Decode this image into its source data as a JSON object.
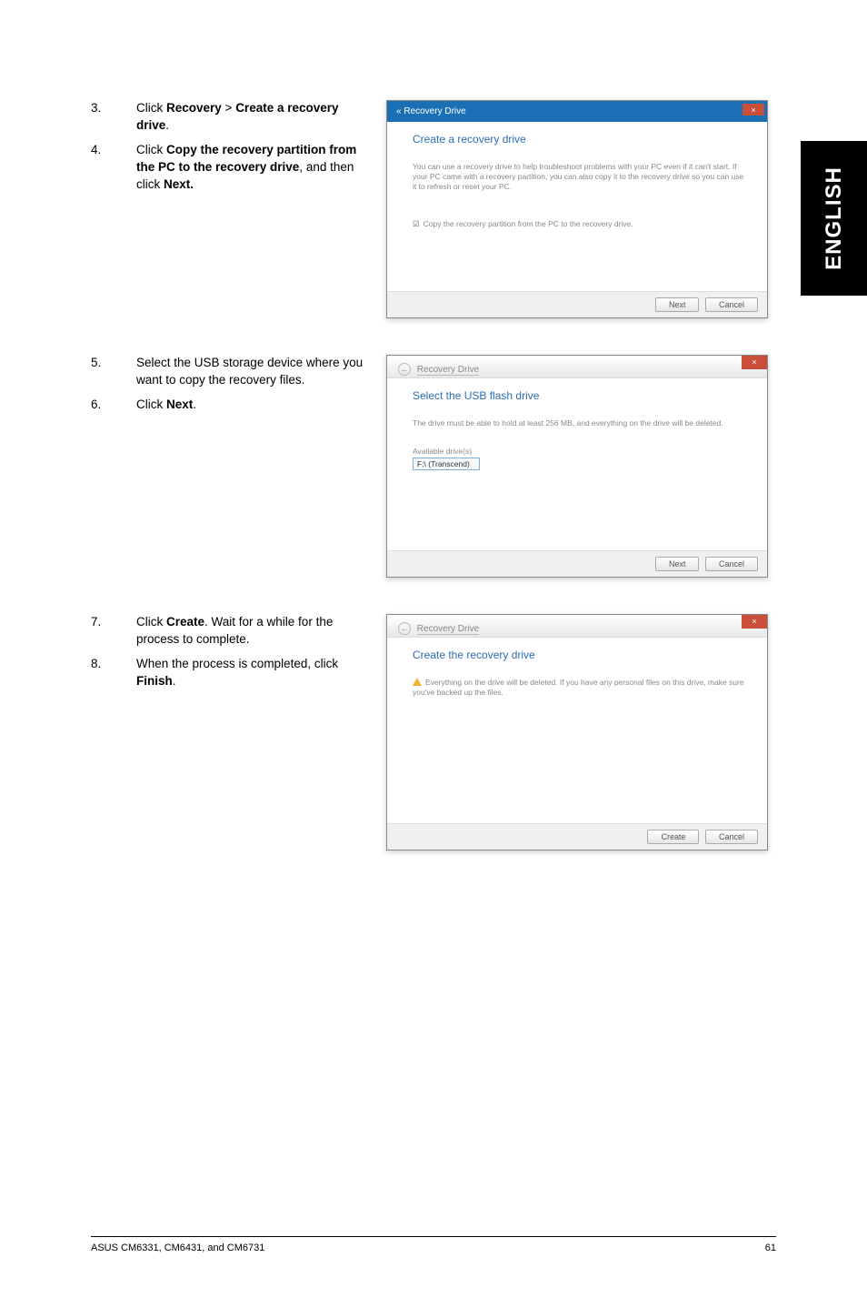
{
  "side_tab": "ENGLISH",
  "section1": {
    "steps": [
      {
        "num": "3.",
        "pre": "Click ",
        "b1": "Recovery",
        "mid": " > ",
        "b2": "Create a recovery drive",
        "post": "."
      },
      {
        "num": "4.",
        "pre": "Click ",
        "b1": "Copy the recovery partition from the PC to the recovery drive",
        "mid": ", and then click ",
        "b2": "Next.",
        "post": ""
      }
    ],
    "dialog": {
      "crumb": "« Recovery Drive",
      "title": "Create a recovery drive",
      "body": "You can use a recovery drive to help troubleshoot problems with your PC even if it can't start. If your PC came with a recovery partition, you can also copy it to the recovery drive so you can use it to refresh or reset your PC.",
      "checkbox": "Copy the recovery partition from the PC to the recovery drive.",
      "btn_next": "Next",
      "btn_cancel": "Cancel"
    }
  },
  "section2": {
    "steps": [
      {
        "num": "5.",
        "text": "Select the USB storage device where you want to copy the recovery files."
      },
      {
        "num": "6.",
        "pre": "Click ",
        "b1": "Next",
        "post": "."
      }
    ],
    "dialog": {
      "crumb": "Recovery Drive",
      "title": "Select the USB flash drive",
      "body": "The drive must be able to hold at least 256 MB, and everything on the drive will be deleted.",
      "drive_label": "Available drive(s)",
      "drive_item": "F:\\ (Transcend)",
      "btn_next": "Next",
      "btn_cancel": "Cancel"
    }
  },
  "section3": {
    "steps": [
      {
        "num": "7.",
        "pre": "Click ",
        "b1": "Create",
        "post": ". Wait for a while for the process to complete."
      },
      {
        "num": "8.",
        "pre": "When the process is completed, click ",
        "b1": "Finish",
        "post": "."
      }
    ],
    "dialog": {
      "crumb": "Recovery Drive",
      "title": "Create the recovery drive",
      "body": "Everything on the drive will be deleted. If you have any personal files on this drive, make sure you've backed up the files.",
      "btn_create": "Create",
      "btn_cancel": "Cancel"
    }
  },
  "footer": {
    "left": "ASUS CM6331, CM6431, and CM6731",
    "right": "61"
  }
}
